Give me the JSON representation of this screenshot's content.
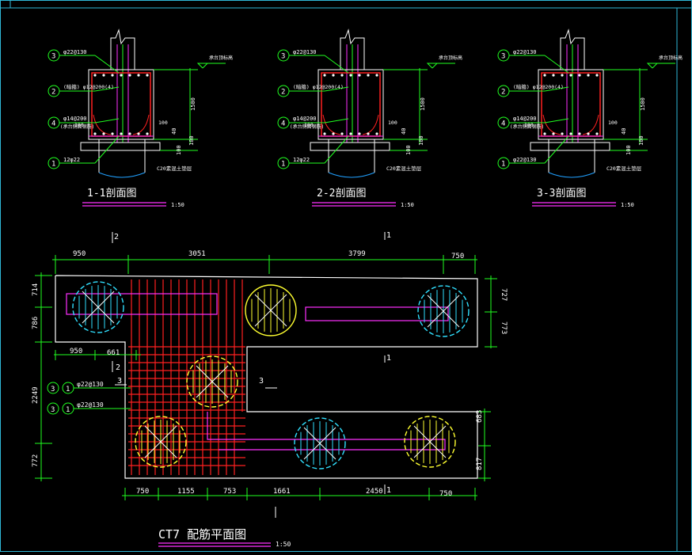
{
  "drawing": {
    "sections": [
      {
        "title": "1-1剖面图",
        "scale": "1:50",
        "labels": {
          "top_bar": "φ22@130",
          "stirrup": "(暗箍) φ12@200(4)",
          "side_bar": "φ14@200",
          "side_note": "(承台侧面钢筋)",
          "bottom_bar": "12φ22",
          "pile": "C20素混土垫层",
          "elev": "承台顶标高",
          "dim_height": "1500",
          "dim_a": "100",
          "dim_b": "100",
          "dim_c": "100",
          "dim_d": "100",
          "dim_40": "40"
        },
        "markers": [
          "3",
          "2",
          "4",
          "1"
        ]
      },
      {
        "title": "2-2剖面图",
        "scale": "1:50",
        "labels": {
          "top_bar": "φ22@130",
          "stirrup": "(暗箍) φ12@200(4)",
          "side_bar": "φ14@200",
          "side_note": "(承台侧面钢筋)",
          "bottom_bar": "12φ22",
          "pile": "C20素混土垫层",
          "elev": "承台顶标高",
          "dim_height": "1500",
          "dim_a": "100",
          "dim_b": "100",
          "dim_c": "100",
          "dim_d": "100",
          "dim_40": "40"
        },
        "markers": [
          "3",
          "2",
          "4",
          "1"
        ]
      },
      {
        "title": "3-3剖面图",
        "scale": "1:50",
        "labels": {
          "top_bar": "φ22@130",
          "stirrup": "(暗箍) φ12@200(4)",
          "side_bar": "φ14@200",
          "side_note": "(承台侧面钢筋)",
          "bottom_bar": "φ22@130",
          "pile": "C20素混土垫层",
          "elev": "承台顶标高",
          "dim_height": "1500",
          "dim_a": "100",
          "dim_b": "100",
          "dim_c": "100",
          "dim_d": "100",
          "dim_40": "40"
        },
        "markers": [
          "3",
          "2",
          "4",
          "1"
        ]
      }
    ],
    "plan": {
      "title": "CT7  配筋平面图",
      "scale": "1:50",
      "top_dims": [
        "950",
        "3051",
        "3799",
        "750"
      ],
      "mid_dims": [
        "950",
        "661"
      ],
      "bottom_dims": [
        "750",
        "1155",
        "753",
        "1661",
        "2450",
        "750"
      ],
      "left_dims": [
        "714",
        "786",
        "2249",
        "772"
      ],
      "right_top_dims": [
        "727",
        "773"
      ],
      "right_bottom_dims": [
        "683",
        "817"
      ],
      "rebar_callouts": [
        {
          "marks": [
            "3",
            "1"
          ],
          "text": "φ22@130"
        },
        {
          "marks": [
            "3",
            "1"
          ],
          "text": "φ22@130"
        }
      ],
      "section_marks": [
        "2",
        "3",
        "3",
        "1",
        "1",
        "1",
        "2"
      ]
    }
  }
}
